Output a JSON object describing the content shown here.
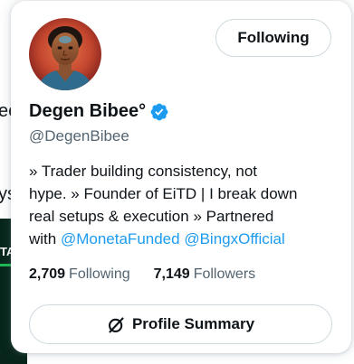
{
  "background": {
    "fragment_1": "ee",
    "fragment_2": "ys",
    "fragment_3": "TA"
  },
  "card": {
    "follow_button_label": "Following",
    "display_name": "Degen Bibee°",
    "handle": "@DegenBibee",
    "bio": {
      "line1": "» Trader building consistency, not",
      "line2": "hype. » Founder of EiTD | I break down",
      "line3": "real setups & execution » Partnered",
      "line4_prefix": "with",
      "mention1": "@MonetaFunded",
      "mention2": "@BingxOfficial"
    },
    "stats": {
      "following_count": "2,709",
      "following_label": "Following",
      "followers_count": "7,149",
      "followers_label": "Followers"
    },
    "summary_button_label": "Profile Summary"
  },
  "icons": {
    "verified": "verified-badge-icon",
    "summary": "grok-icon"
  },
  "colors": {
    "accent_blue": "#1d9bf0",
    "text_primary": "#0f1419",
    "text_secondary": "#536471",
    "border": "#cfd9de"
  }
}
